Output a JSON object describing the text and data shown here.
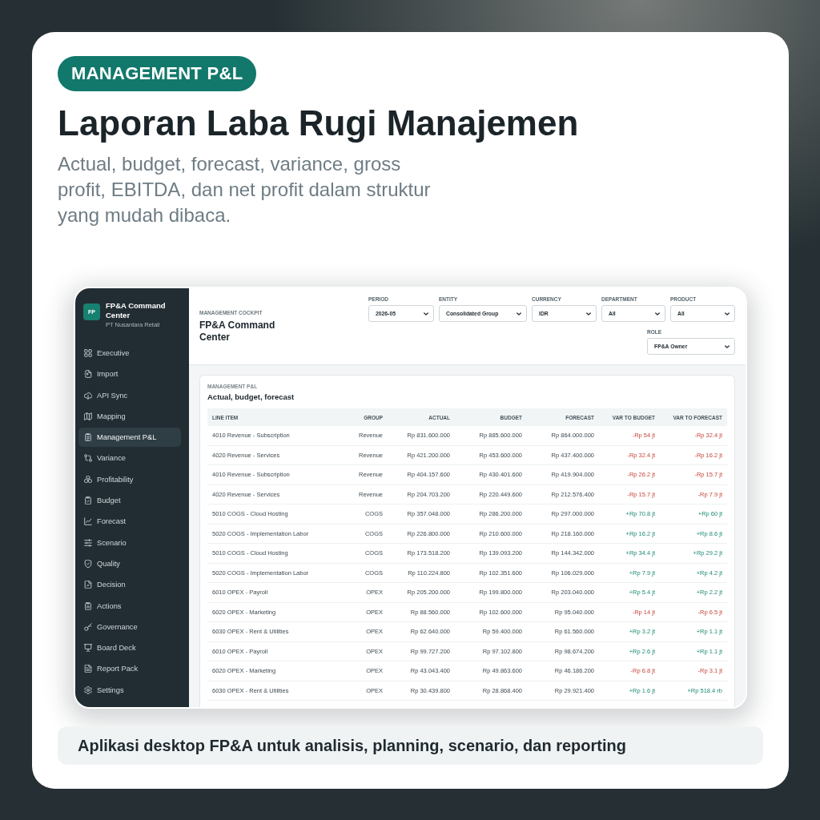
{
  "badge": "MANAGEMENT P&L",
  "title": "Laporan Laba Rugi Manajemen",
  "subtitle": "Actual, budget, forecast, variance, gross profit, EBITDA, dan net profit dalam struktur yang mudah dibaca.",
  "app": {
    "sidebar": {
      "brand": {
        "logo": "FP",
        "name": "FP&A Command Center",
        "company": "PT Nusantara Retail"
      },
      "items": [
        {
          "label": "Executive",
          "selected": false
        },
        {
          "label": "Import",
          "selected": false
        },
        {
          "label": "API Sync",
          "selected": false
        },
        {
          "label": "Mapping",
          "selected": false
        },
        {
          "label": "Management P&L",
          "selected": true
        },
        {
          "label": "Variance",
          "selected": false
        },
        {
          "label": "Profitability",
          "selected": false
        },
        {
          "label": "Budget",
          "selected": false
        },
        {
          "label": "Forecast",
          "selected": false
        },
        {
          "label": "Scenario",
          "selected": false
        },
        {
          "label": "Quality",
          "selected": false
        },
        {
          "label": "Decision",
          "selected": false
        },
        {
          "label": "Actions",
          "selected": false
        },
        {
          "label": "Governance",
          "selected": false
        },
        {
          "label": "Board Deck",
          "selected": false
        },
        {
          "label": "Report Pack",
          "selected": false
        },
        {
          "label": "Settings",
          "selected": false
        }
      ]
    },
    "header": {
      "eyebrow": "MANAGEMENT COCKPIT",
      "title": "FP&A Command Center",
      "filters": [
        {
          "label": "PERIOD",
          "value": "2026-05"
        },
        {
          "label": "ENTITY",
          "value": "Consolidated Group"
        },
        {
          "label": "CURRENCY",
          "value": "IDR"
        },
        {
          "label": "DEPARTMENT",
          "value": "All"
        },
        {
          "label": "PRODUCT",
          "value": "All"
        },
        {
          "label": "ROLE",
          "value": "FP&A Owner"
        }
      ]
    },
    "panel": {
      "eyebrow": "MANAGEMENT P&L",
      "title": "Actual, budget, forecast",
      "table": {
        "columns": [
          "LINE ITEM",
          "GROUP",
          "ACTUAL",
          "BUDGET",
          "FORECAST",
          "VAR TO BUDGET",
          "VAR TO FORECAST"
        ],
        "rows": [
          {
            "line_item": "4010 Revenue - Subscription",
            "group": "Revenue",
            "actual": "Rp 831.600.000",
            "budget": "Rp 885.600.000",
            "forecast": "Rp 864.000.000",
            "var_to_budget": {
              "text": "-Rp 54 jt",
              "kind": "negative"
            },
            "var_to_forecast": {
              "text": "-Rp 32.4 jt",
              "kind": "negative"
            }
          },
          {
            "line_item": "4020 Revenue - Services",
            "group": "Revenue",
            "actual": "Rp 421.200.000",
            "budget": "Rp 453.600.000",
            "forecast": "Rp 437.400.000",
            "var_to_budget": {
              "text": "-Rp 32.4 jt",
              "kind": "negative"
            },
            "var_to_forecast": {
              "text": "-Rp 16.2 jt",
              "kind": "negative"
            }
          },
          {
            "line_item": "4010 Revenue - Subscription",
            "group": "Revenue",
            "actual": "Rp 404.157.600",
            "budget": "Rp 430.401.600",
            "forecast": "Rp 419.904.000",
            "var_to_budget": {
              "text": "-Rp 26.2 jt",
              "kind": "negative"
            },
            "var_to_forecast": {
              "text": "-Rp 15.7 jt",
              "kind": "negative"
            }
          },
          {
            "line_item": "4020 Revenue - Services",
            "group": "Revenue",
            "actual": "Rp 204.703.200",
            "budget": "Rp 220.449.600",
            "forecast": "Rp 212.576.400",
            "var_to_budget": {
              "text": "-Rp 15.7 jt",
              "kind": "negative"
            },
            "var_to_forecast": {
              "text": "-Rp 7.9 jt",
              "kind": "negative"
            }
          },
          {
            "line_item": "5010 COGS - Cloud Hosting",
            "group": "COGS",
            "actual": "Rp 357.048.000",
            "budget": "Rp 286.200.000",
            "forecast": "Rp 297.000.000",
            "var_to_budget": {
              "text": "+Rp 70.8 jt",
              "kind": "positive"
            },
            "var_to_forecast": {
              "text": "+Rp 60 jt",
              "kind": "positive"
            }
          },
          {
            "line_item": "5020 COGS - Implementation Labor",
            "group": "COGS",
            "actual": "Rp 226.800.000",
            "budget": "Rp 210.600.000",
            "forecast": "Rp 218.160.000",
            "var_to_budget": {
              "text": "+Rp 16.2 jt",
              "kind": "positive"
            },
            "var_to_forecast": {
              "text": "+Rp 8.6 jt",
              "kind": "positive"
            }
          },
          {
            "line_item": "5010 COGS - Cloud Hosting",
            "group": "COGS",
            "actual": "Rp 173.518.200",
            "budget": "Rp 139.093.200",
            "forecast": "Rp 144.342.000",
            "var_to_budget": {
              "text": "+Rp 34.4 jt",
              "kind": "positive"
            },
            "var_to_forecast": {
              "text": "+Rp 29.2 jt",
              "kind": "positive"
            }
          },
          {
            "line_item": "5020 COGS - Implementation Labor",
            "group": "COGS",
            "actual": "Rp 110.224.800",
            "budget": "Rp 102.351.600",
            "forecast": "Rp 106.029.000",
            "var_to_budget": {
              "text": "+Rp 7.9 jt",
              "kind": "positive"
            },
            "var_to_forecast": {
              "text": "+Rp 4.2 jt",
              "kind": "positive"
            }
          },
          {
            "line_item": "6010 OPEX - Payroll",
            "group": "OPEX",
            "actual": "Rp 205.200.000",
            "budget": "Rp 199.800.000",
            "forecast": "Rp 203.040.000",
            "var_to_budget": {
              "text": "+Rp 5.4 jt",
              "kind": "positive"
            },
            "var_to_forecast": {
              "text": "+Rp 2.2 jt",
              "kind": "positive"
            }
          },
          {
            "line_item": "6020 OPEX - Marketing",
            "group": "OPEX",
            "actual": "Rp 88.560.000",
            "budget": "Rp 102.600.000",
            "forecast": "Rp 95.040.000",
            "var_to_budget": {
              "text": "-Rp 14 jt",
              "kind": "negative"
            },
            "var_to_forecast": {
              "text": "-Rp 6.5 jt",
              "kind": "negative"
            }
          },
          {
            "line_item": "6030 OPEX - Rent & Utilities",
            "group": "OPEX",
            "actual": "Rp 62.640.000",
            "budget": "Rp 59.400.000",
            "forecast": "Rp 61.560.000",
            "var_to_budget": {
              "text": "+Rp 3.2 jt",
              "kind": "positive"
            },
            "var_to_forecast": {
              "text": "+Rp 1.1 jt",
              "kind": "positive"
            }
          },
          {
            "line_item": "6010 OPEX - Payroll",
            "group": "OPEX",
            "actual": "Rp 99.727.200",
            "budget": "Rp 97.102.800",
            "forecast": "Rp 98.674.200",
            "var_to_budget": {
              "text": "+Rp 2.6 jt",
              "kind": "positive"
            },
            "var_to_forecast": {
              "text": "+Rp 1.1 jt",
              "kind": "positive"
            }
          },
          {
            "line_item": "6020 OPEX - Marketing",
            "group": "OPEX",
            "actual": "Rp 43.043.400",
            "budget": "Rp 49.863.600",
            "forecast": "Rp 46.186.200",
            "var_to_budget": {
              "text": "-Rp 6.8 jt",
              "kind": "negative"
            },
            "var_to_forecast": {
              "text": "-Rp 3.1 jt",
              "kind": "negative"
            }
          },
          {
            "line_item": "6030 OPEX - Rent & Utilities",
            "group": "OPEX",
            "actual": "Rp 30.439.800",
            "budget": "Rp 28.868.400",
            "forecast": "Rp 29.921.400",
            "var_to_budget": {
              "text": "+Rp 1.6 jt",
              "kind": "positive"
            },
            "var_to_forecast": {
              "text": "+Rp 518.4 rb",
              "kind": "positive"
            }
          }
        ]
      }
    }
  },
  "caption": "Aplikasi desktop FP&A untuk analisis, planning, scenario, dan reporting"
}
